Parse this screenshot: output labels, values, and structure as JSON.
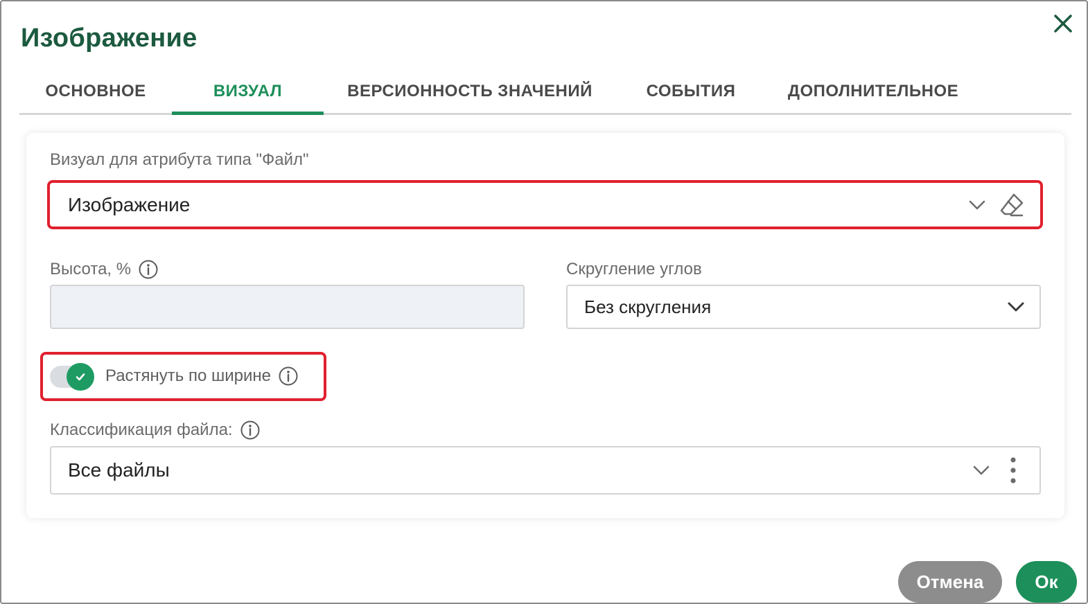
{
  "dialog": {
    "title": "Изображение",
    "close_icon": "close-icon"
  },
  "tabs": [
    {
      "label": "ОСНОВНОЕ",
      "active": false
    },
    {
      "label": "ВИЗУАЛ",
      "active": true
    },
    {
      "label": "ВЕРСИОННОСТЬ ЗНАЧЕНИЙ",
      "active": false
    },
    {
      "label": "СОБЫТИЯ",
      "active": false
    },
    {
      "label": "ДОПОЛНИТЕЛЬНОЕ",
      "active": false
    }
  ],
  "visual": {
    "label": "Визуал для атрибута типа \"Файл\"",
    "value": "Изображение",
    "icons": [
      "chevron-down-icon",
      "eraser-icon"
    ]
  },
  "height": {
    "label": "Высота, %",
    "value": "",
    "icon": "info-icon"
  },
  "corners": {
    "label": "Скругление углов",
    "value": "Без скругления",
    "icon": "chevron-down-icon"
  },
  "stretch": {
    "label": "Растянуть по ширине",
    "checked": true,
    "icon": "info-icon"
  },
  "classification": {
    "label": "Классификация файла:",
    "value": "Все файлы",
    "icons": [
      "chevron-down-icon",
      "more-vertical-icon"
    ]
  },
  "footer": {
    "cancel_label": "Отмена",
    "ok_label": "Ок"
  },
  "colors": {
    "accent": "#1d8f5a",
    "title": "#1c5a3f",
    "highlight": "#e0202e",
    "cancel": "#8d8d8d"
  }
}
